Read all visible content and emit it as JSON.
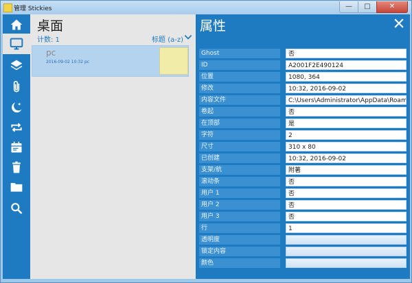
{
  "window": {
    "title": "管理 Stickies",
    "min_label": "—",
    "max_label": "□",
    "close_label": "✕"
  },
  "sidebar": {
    "items": [
      {
        "icon": "home-icon"
      },
      {
        "icon": "monitor-icon"
      },
      {
        "icon": "layers-icon"
      },
      {
        "icon": "paperclip-icon"
      },
      {
        "icon": "moon-star-icon"
      },
      {
        "icon": "repeat-icon"
      },
      {
        "icon": "calendar-icon"
      },
      {
        "icon": "trash-icon"
      },
      {
        "icon": "folder-icon"
      },
      {
        "icon": "search-icon"
      }
    ],
    "active_index": 1
  },
  "list": {
    "title": "桌面",
    "count_label": "计数: 1",
    "sort_label": "标题 (a-z)",
    "items": [
      {
        "name": "pc",
        "date": "2016-09-02 10:32 pc"
      }
    ]
  },
  "properties": {
    "title": "属性",
    "rows": [
      {
        "label": "Ghost",
        "value": "否"
      },
      {
        "label": "ID",
        "value": "A2001F2E490124"
      },
      {
        "label": "位置",
        "value": "1080, 364"
      },
      {
        "label": "修改",
        "value": "10:32, 2016-09-02"
      },
      {
        "label": "内容文件",
        "value": "C:\\Users\\Administrator\\AppData\\Roaming"
      },
      {
        "label": "卷起",
        "value": "否"
      },
      {
        "label": "在顶部",
        "value": "是"
      },
      {
        "label": "字符",
        "value": "2"
      },
      {
        "label": "尺寸",
        "value": "310 x 80"
      },
      {
        "label": "已创建",
        "value": "10:32, 2016-09-02"
      },
      {
        "label": "支架/航",
        "value": "附著"
      },
      {
        "label": "滚动条",
        "value": "否"
      },
      {
        "label": "用户 1",
        "value": "否"
      },
      {
        "label": "用户 2",
        "value": "否"
      },
      {
        "label": "用户 3",
        "value": "否"
      },
      {
        "label": "行",
        "value": "1"
      },
      {
        "label": "透明度",
        "value": ""
      },
      {
        "label": "锁定内容",
        "value": ""
      },
      {
        "label": "颜色",
        "value": ""
      }
    ]
  },
  "colors": {
    "accent": "#1f7bc1",
    "label_bg": "#3b90d1",
    "note_yellow": "#f1eca8"
  }
}
